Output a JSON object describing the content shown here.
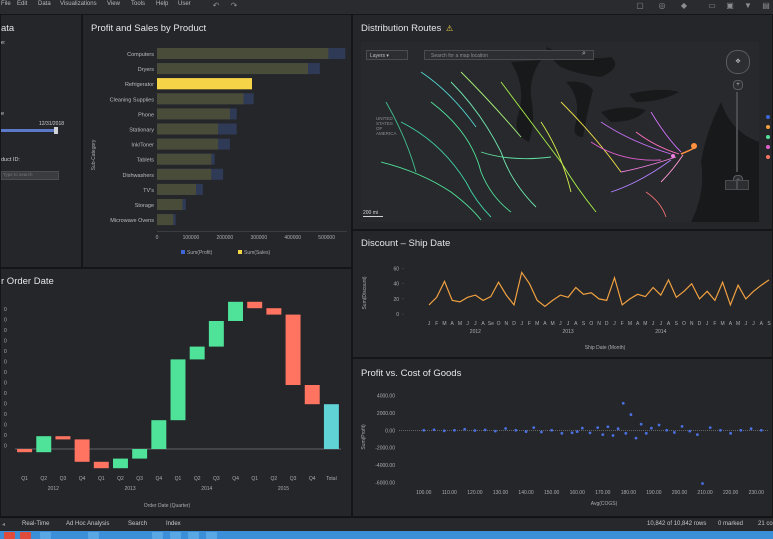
{
  "menu": {
    "items": [
      "File",
      "Edit",
      "Data",
      "Visualizations",
      "View",
      "Tools",
      "Help",
      "User"
    ]
  },
  "panel_data": {
    "title_fragment": "ata",
    "label_a": "e:",
    "date_value": "12/31/2018",
    "product_label": "duct ID:",
    "search_placeholder": "Type to search"
  },
  "panel_profit_sales": {
    "title": "Profit and Sales by Product",
    "ylabel": "Sub-Category",
    "legend": [
      "Sum(Profit)",
      "Sum(Sales)"
    ]
  },
  "panel_routes": {
    "title": "Distribution Routes",
    "layers_label": "Layers",
    "search_placeholder": "Search for a map location",
    "country_label": [
      "UNITED",
      "STATES",
      "OF",
      "AMERICA"
    ],
    "scale_label": "200 mi"
  },
  "panel_order_date": {
    "title": "r Order Date",
    "xlabel": "Order Date (Quarter)"
  },
  "panel_discount": {
    "title": "Discount – Ship Date",
    "ylabel": "Sum(Discount)",
    "xlabel": "Ship Date (Month)"
  },
  "panel_profit_cogs": {
    "title": "Profit vs. Cost of Goods",
    "ylabel": "Sum(Profit)",
    "xlabel": "Avg(COGS)"
  },
  "status": {
    "tabs": [
      "Real-Time",
      "Ad Hoc Analysis",
      "Search",
      "Index"
    ],
    "rows": "10,842 of 10,842 rows",
    "marked": "0 marked",
    "columns": "21 co"
  },
  "colors": {
    "profit": "#4a4c3a",
    "sales": "#2f3a57",
    "highlight": "#f5d547",
    "up": "#4fe39a",
    "down": "#ff7461",
    "total": "#5fd3d6",
    "line": "#f0a040",
    "scatter": "#4a6fe0"
  },
  "chart_data": [
    {
      "type": "bar",
      "title": "Profit and Sales by Product",
      "ylabel": "Sub-Category",
      "categories": [
        "Computers",
        "Dryers",
        "Refrigerator",
        "Cleaning Supplies",
        "Phone",
        "Stationary",
        "Ink/Toner",
        "Tablets",
        "Dishwashers",
        "TV's",
        "Storage",
        "Microwave Ovens"
      ],
      "series": [
        {
          "name": "Sum(Profit)",
          "values": [
            505000,
            445000,
            280000,
            255000,
            215000,
            180000,
            180000,
            160000,
            160000,
            115000,
            75000,
            48000
          ]
        },
        {
          "name": "Sum(Sales)",
          "values": [
            555000,
            480000,
            280000,
            285000,
            235000,
            235000,
            215000,
            170000,
            195000,
            135000,
            85000,
            55000
          ]
        }
      ],
      "xticks": [
        "0",
        "100000",
        "200000",
        "300000",
        "400000",
        "500000"
      ],
      "xlim": [
        0,
        560000
      ]
    },
    {
      "type": "bar",
      "title": "Order Date",
      "xlabel": "Order Date (Quarter)",
      "categories": [
        "Q1",
        "Q2",
        "Q3",
        "Q4",
        "Q1",
        "Q2",
        "Q3",
        "Q4",
        "Q1",
        "Q2",
        "Q3",
        "Q4",
        "Q1",
        "Q2",
        "Q3",
        "Q4",
        "Total"
      ],
      "groups": [
        "2012",
        "2013",
        "2014",
        "2015"
      ],
      "waterfall_steps": [
        [
          0,
          -0.5
        ],
        [
          -0.5,
          2
        ],
        [
          2,
          1.5
        ],
        [
          1.5,
          -2
        ],
        [
          -2,
          -3
        ],
        [
          -3,
          -1.5
        ],
        [
          -1.5,
          0
        ],
        [
          0,
          4.5
        ],
        [
          4.5,
          14
        ],
        [
          14,
          16
        ],
        [
          16,
          20
        ],
        [
          20,
          23
        ],
        [
          23,
          22
        ],
        [
          22,
          21
        ],
        [
          21,
          10
        ],
        [
          10,
          7
        ],
        [
          7,
          6.5
        ]
      ],
      "total": [
        0,
        7
      ]
    },
    {
      "type": "line",
      "title": "Discount – Ship Date",
      "ylabel": "Sum(Discount)",
      "xlabel": "Ship Date (Month)",
      "x": [
        "J",
        "F",
        "M",
        "A",
        "M",
        "J",
        "J",
        "A",
        "Se",
        "O",
        "N",
        "D",
        "J",
        "F",
        "M",
        "A",
        "M",
        "J",
        "J",
        "A",
        "S",
        "O",
        "N",
        "D",
        "J",
        "F",
        "M",
        "A",
        "M",
        "J",
        "J",
        "A",
        "S",
        "O",
        "N",
        "D",
        "J",
        "F",
        "M",
        "A",
        "M",
        "J",
        "J",
        "A",
        "S"
      ],
      "groups": [
        "2012",
        "2013",
        "2014"
      ],
      "values": [
        12,
        22,
        43,
        18,
        16,
        22,
        25,
        18,
        23,
        42,
        25,
        12,
        55,
        40,
        18,
        10,
        18,
        25,
        22,
        35,
        26,
        28,
        20,
        18,
        48,
        12,
        20,
        26,
        23,
        35,
        25,
        45,
        22,
        30,
        40,
        20,
        30,
        18,
        42,
        12,
        38,
        20,
        30,
        38,
        45
      ],
      "yticks": [
        0,
        20,
        40,
        60
      ],
      "ylim": [
        0,
        70
      ]
    },
    {
      "type": "scatter",
      "title": "Profit vs. Cost of Goods",
      "xlabel": "Avg(COGS)",
      "ylabel": "Sum(Profit)",
      "yticks": [
        "4000.00",
        "2000.00",
        "0.00",
        "-2000.00",
        "-4000.00",
        "-6000.00"
      ],
      "xticks": [
        "100.00",
        "110.00",
        "120.00",
        "130.00",
        "140.00",
        "150.00",
        "160.00",
        "170.00",
        "180.00",
        "190.00",
        "200.00",
        "210.00",
        "220.00",
        "230.00"
      ],
      "xlim": [
        95,
        235
      ],
      "ylim": [
        -6500,
        4500
      ],
      "points": [
        [
          100,
          0
        ],
        [
          104,
          60
        ],
        [
          108,
          -60
        ],
        [
          112,
          0
        ],
        [
          116,
          120
        ],
        [
          120,
          -30
        ],
        [
          124,
          40
        ],
        [
          128,
          -100
        ],
        [
          132,
          200
        ],
        [
          136,
          0
        ],
        [
          140,
          -150
        ],
        [
          143,
          300
        ],
        [
          146,
          -200
        ],
        [
          150,
          0
        ],
        [
          154,
          -350
        ],
        [
          158,
          -280
        ],
        [
          160,
          -150
        ],
        [
          162,
          250
        ],
        [
          165,
          -300
        ],
        [
          168,
          300
        ],
        [
          170,
          -500
        ],
        [
          172,
          400
        ],
        [
          174,
          -600
        ],
        [
          176,
          180
        ],
        [
          178,
          3100
        ],
        [
          179,
          -350
        ],
        [
          181,
          1800
        ],
        [
          183,
          -900
        ],
        [
          185,
          700
        ],
        [
          187,
          -350
        ],
        [
          189,
          250
        ],
        [
          192,
          600
        ],
        [
          195,
          0
        ],
        [
          198,
          -250
        ],
        [
          201,
          450
        ],
        [
          204,
          -100
        ],
        [
          207,
          -500
        ],
        [
          209,
          -6100
        ],
        [
          212,
          300
        ],
        [
          216,
          0
        ],
        [
          220,
          -350
        ],
        [
          224,
          0
        ],
        [
          228,
          180
        ],
        [
          232,
          0
        ]
      ]
    }
  ]
}
